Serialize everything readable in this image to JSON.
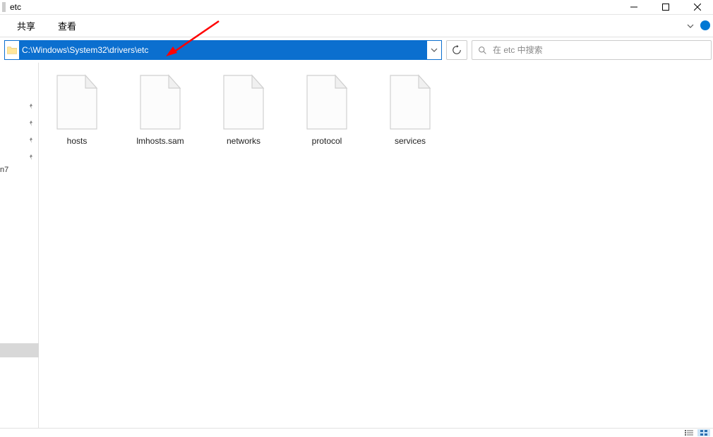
{
  "window": {
    "title": "etc"
  },
  "ribbon": {
    "tabs": [
      "共享",
      "查看"
    ]
  },
  "address_bar": {
    "path": "C:\\Windows\\System32\\drivers\\etc"
  },
  "search": {
    "placeholder": "在 etc 中搜索"
  },
  "files": [
    {
      "name": "hosts"
    },
    {
      "name": "lmhosts.sam"
    },
    {
      "name": "networks"
    },
    {
      "name": "protocol"
    },
    {
      "name": "services"
    }
  ],
  "sidebar": {
    "partial_text": "n7"
  }
}
